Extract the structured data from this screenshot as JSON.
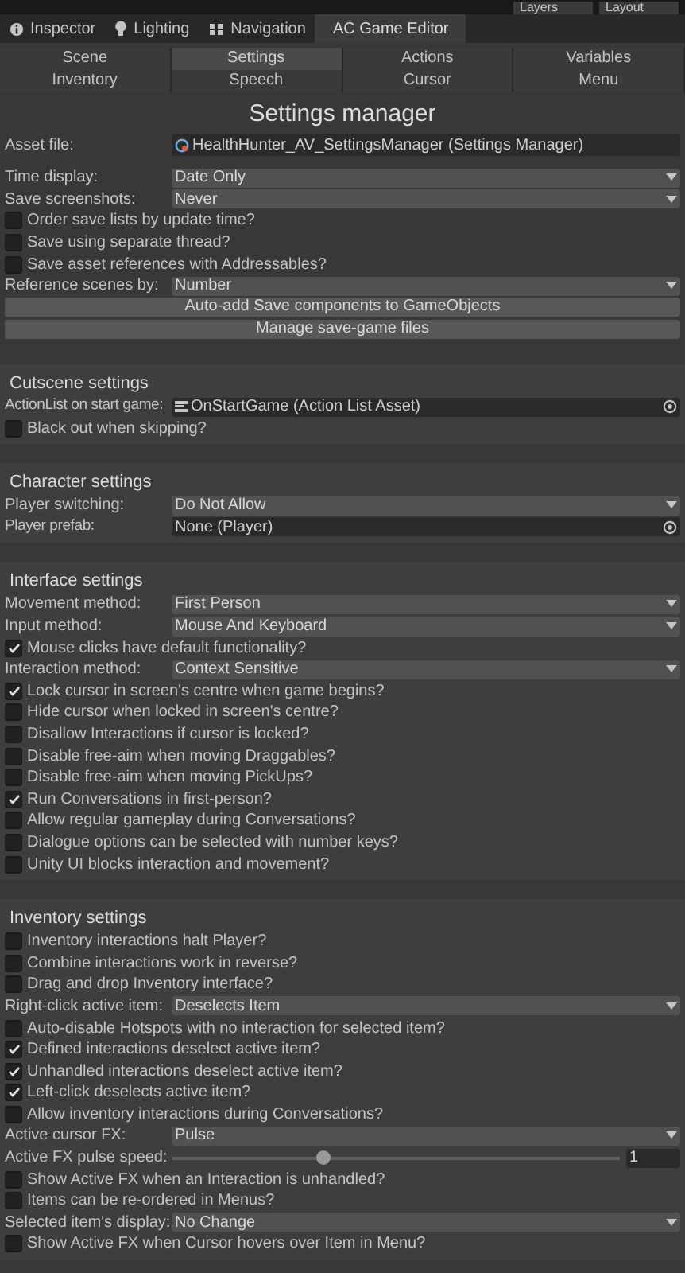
{
  "toolbar": {
    "layers": "Layers",
    "layout": "Layout"
  },
  "tabs": [
    {
      "label": "Inspector",
      "selected": false
    },
    {
      "label": "Lighting",
      "selected": false
    },
    {
      "label": "Navigation",
      "selected": false
    },
    {
      "label": "AC Game Editor",
      "selected": true
    }
  ],
  "manager_tabs": [
    {
      "label": "Scene",
      "selected": false
    },
    {
      "label": "Settings",
      "selected": true
    },
    {
      "label": "Actions",
      "selected": false
    },
    {
      "label": "Variables",
      "selected": false
    },
    {
      "label": "Inventory",
      "selected": false
    },
    {
      "label": "Speech",
      "selected": false
    },
    {
      "label": "Cursor",
      "selected": false
    },
    {
      "label": "Menu",
      "selected": false
    }
  ],
  "title": "Settings manager",
  "asset_file": {
    "label": "Asset file:",
    "value": "HealthHunter_AV_SettingsManager (Settings Manager)"
  },
  "sections": [
    {
      "rows": [
        {
          "kind": "dropdown",
          "label": "Time display:",
          "value": "Date Only"
        },
        {
          "kind": "dropdown",
          "label": "Save screenshots:",
          "value": "Never"
        },
        {
          "kind": "checkbox",
          "label": "Order save lists by update time?",
          "checked": false
        },
        {
          "kind": "checkbox",
          "label": "Save using separate thread?",
          "checked": false
        },
        {
          "kind": "checkbox",
          "label": "Save asset references with Addressables?",
          "checked": false
        },
        {
          "kind": "dropdown",
          "label": "Reference scenes by:",
          "value": "Number"
        },
        {
          "kind": "button",
          "label": "Auto-add Save components to GameObjects"
        },
        {
          "kind": "button",
          "label": "Manage save-game files"
        }
      ]
    },
    {
      "title": "Cutscene settings",
      "rows": [
        {
          "kind": "actionlist",
          "label": "ActionList on start game:",
          "value": "OnStartGame (Action List Asset)"
        },
        {
          "kind": "checkbox",
          "label": "Black out when skipping?",
          "checked": false
        }
      ]
    },
    {
      "title": "Character settings",
      "rows": [
        {
          "kind": "dropdown",
          "label": "Player switching:",
          "value": "Do Not Allow"
        },
        {
          "kind": "object",
          "label": "Player prefab:",
          "value": "None (Player)"
        }
      ]
    },
    {
      "title": "Interface settings",
      "rows": [
        {
          "kind": "dropdown",
          "label": "Movement method:",
          "value": "First Person"
        },
        {
          "kind": "dropdown",
          "label": "Input method:",
          "value": "Mouse And Keyboard"
        },
        {
          "kind": "checkbox",
          "label": "Mouse clicks have default functionality?",
          "checked": true
        },
        {
          "kind": "dropdown",
          "label": "Interaction method:",
          "value": "Context Sensitive"
        },
        {
          "kind": "checkbox",
          "label": "Lock cursor in screen's centre when game begins?",
          "checked": true
        },
        {
          "kind": "checkbox",
          "label": "Hide cursor when locked in screen's centre?",
          "checked": false
        },
        {
          "kind": "checkbox",
          "label": "Disallow Interactions if cursor is locked?",
          "checked": false
        },
        {
          "kind": "checkbox",
          "label": "Disable free-aim when moving Draggables?",
          "checked": false
        },
        {
          "kind": "checkbox",
          "label": "Disable free-aim when moving PickUps?",
          "checked": false
        },
        {
          "kind": "checkbox",
          "label": "Run Conversations in first-person?",
          "checked": true
        },
        {
          "kind": "checkbox",
          "label": "Allow regular gameplay during Conversations?",
          "checked": false
        },
        {
          "kind": "checkbox",
          "label": "Dialogue options can be selected with number keys?",
          "checked": false
        },
        {
          "kind": "checkbox",
          "label": "Unity UI blocks interaction and movement?",
          "checked": false
        }
      ]
    },
    {
      "title": "Inventory settings",
      "rows": [
        {
          "kind": "checkbox",
          "label": "Inventory interactions halt Player?",
          "checked": false
        },
        {
          "kind": "checkbox",
          "label": "Combine interactions work in reverse?",
          "checked": false
        },
        {
          "kind": "checkbox",
          "label": "Drag and drop Inventory interface?",
          "checked": false
        },
        {
          "kind": "dropdown",
          "label": "Right-click active item:",
          "value": "Deselects Item"
        },
        {
          "kind": "checkbox",
          "label": "Auto-disable Hotspots with no interaction for selected item?",
          "checked": false
        },
        {
          "kind": "checkbox",
          "label": "Defined interactions deselect active item?",
          "checked": true
        },
        {
          "kind": "checkbox",
          "label": "Unhandled interactions deselect active item?",
          "checked": true
        },
        {
          "kind": "checkbox",
          "label": "Left-click deselects active item?",
          "checked": true
        },
        {
          "kind": "checkbox",
          "label": "Allow inventory interactions during Conversations?",
          "checked": false
        },
        {
          "kind": "dropdown",
          "label": "Active cursor FX:",
          "value": "Pulse"
        },
        {
          "kind": "slider",
          "label": "Active FX pulse speed:",
          "level": 0.34,
          "value": "1"
        },
        {
          "kind": "checkbox",
          "label": "Show Active FX when an Interaction is unhandled?",
          "checked": false
        },
        {
          "kind": "checkbox",
          "label": "Items can be re-ordered in Menus?",
          "checked": false
        },
        {
          "kind": "dropdown",
          "label": "Selected item's display:",
          "value": "No Change"
        },
        {
          "kind": "checkbox",
          "label": "Show Active FX when Cursor hovers over Item in Menu?",
          "checked": false
        }
      ]
    }
  ]
}
